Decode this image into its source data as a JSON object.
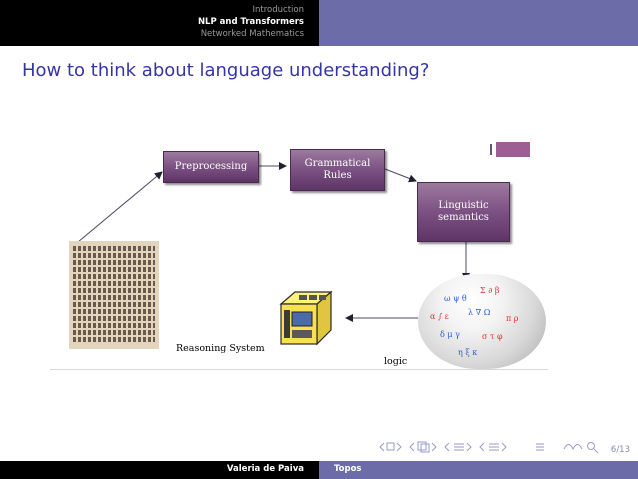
{
  "header": {
    "sections": [
      "Introduction",
      "NLP and Transformers",
      "Networked Mathematics"
    ],
    "active_index": 1
  },
  "slide": {
    "title": "How to think about language understanding?",
    "figure": {
      "preprocessing": "Preprocessing",
      "grammatical_line1": "Grammatical",
      "grammatical_line2": "Rules",
      "semantics_line1": "Linguistic",
      "semantics_line2": "semantics",
      "reasoning_system": "Reasoning System",
      "logic": "logic"
    },
    "page_number": "6/13"
  },
  "footer": {
    "author": "Valeria de Paiva",
    "topic": "Topos"
  },
  "colors": {
    "header_bar": "#000000",
    "header_panel": "#6c6ca8",
    "title": "#3535a8",
    "box_purple": "#7e5585"
  },
  "nav_icons": [
    "frame-left-icon",
    "frame-right-icon",
    "subsection-left-icon",
    "subsection-right-icon",
    "section-left-icon",
    "section-right-icon",
    "align-icon",
    "search-icon"
  ]
}
